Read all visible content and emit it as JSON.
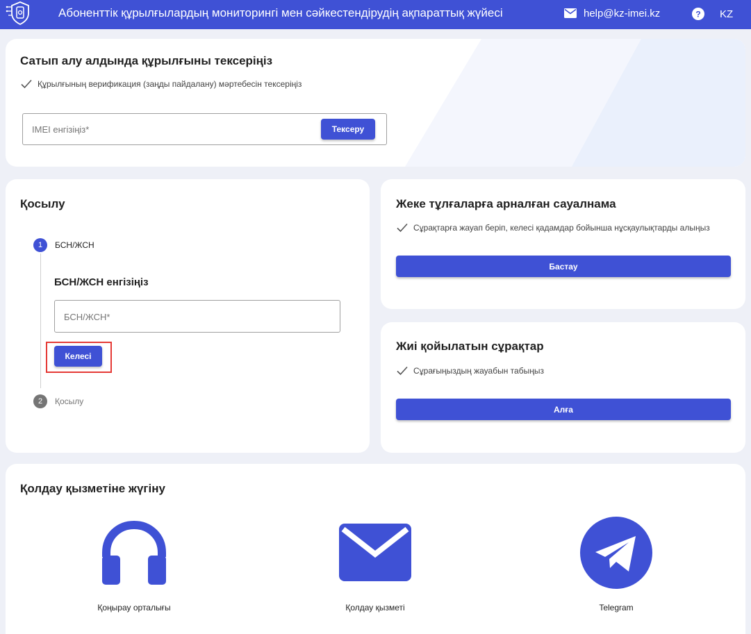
{
  "header": {
    "app_title": "Абоненттік құрылғылардың мониторингі мен сәйкестендірудің ақпараттық жүйесі",
    "email": "help@kz-imei.kz",
    "language": "KZ"
  },
  "check_device": {
    "title": "Сатып алу алдында құрылғыны тексеріңіз",
    "description": "Құрылғының верификация (заңды пайдалану) мәртебесін тексеріңіз",
    "imei_placeholder": "IMEI енгізіңіз*",
    "check_button": "Тексеру"
  },
  "connect": {
    "title": "Қосылу",
    "steps": [
      {
        "number": "1",
        "label": "БСН/ЖСН"
      },
      {
        "number": "2",
        "label": "Қосылу"
      }
    ],
    "step1_heading": "БСН/ЖСН енгізіңіз",
    "bin_placeholder": "БСН/ЖСН*",
    "next_button": "Келесі"
  },
  "survey": {
    "title": "Жеке тұлғаларға арналған сауалнама",
    "description": "Сұрақтарға жауап беріп, келесі қадамдар бойынша нұсқаулықтарды алыңыз",
    "start_button": "Бастау"
  },
  "faq": {
    "title": "Жиі қойылатын сұрақтар",
    "description": "Сұрағыңыздың жауабын табыңыз",
    "forward_button": "Алға"
  },
  "support": {
    "title": "Қолдау қызметіне жүгіну",
    "items": [
      {
        "label": "Қоңырау орталығы",
        "icon": "headphones-icon"
      },
      {
        "label": "Қолдау қызметі",
        "icon": "mail-icon"
      },
      {
        "label": "Telegram",
        "icon": "telegram-icon"
      }
    ]
  },
  "colors": {
    "primary": "#3f51d5",
    "background": "#eef0f7",
    "highlight": "#e53935"
  }
}
